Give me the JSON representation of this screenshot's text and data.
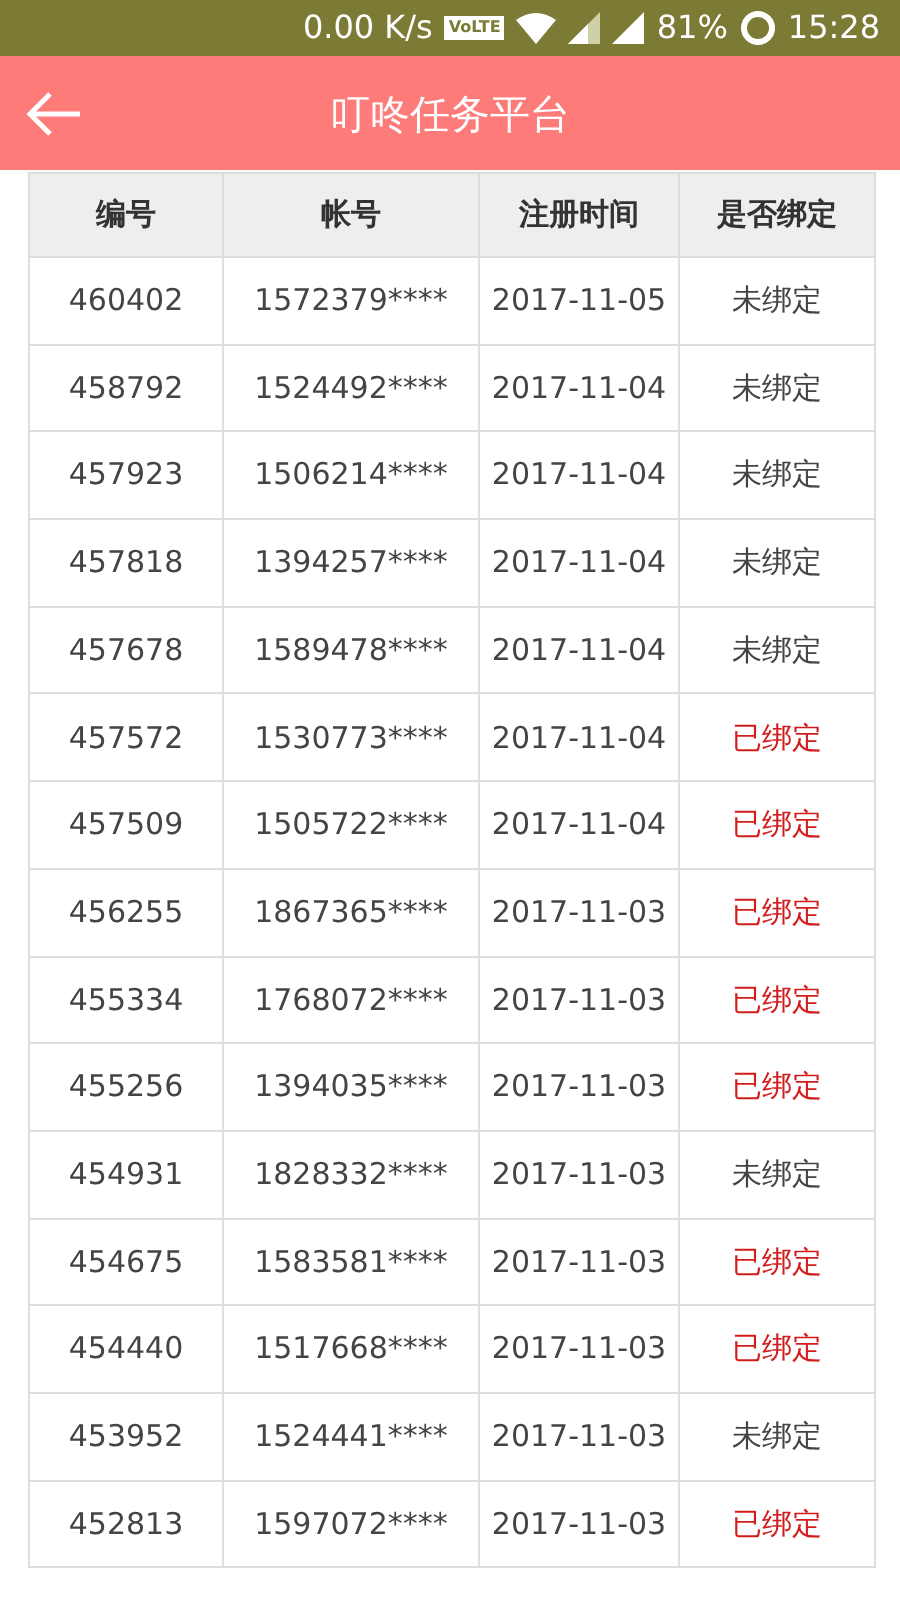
{
  "status_bar": {
    "speed": "0.00 K/s",
    "volte": "VoLTE",
    "battery": "81%",
    "time": "15:28"
  },
  "header": {
    "title": "叮咚任务平台"
  },
  "table": {
    "columns": [
      "编号",
      "帐号",
      "注册时间",
      "是否绑定"
    ],
    "rows": [
      {
        "id": "460402",
        "account": "1572379****",
        "date": "2017-11-05",
        "status": "未绑定",
        "bound": false
      },
      {
        "id": "458792",
        "account": "1524492****",
        "date": "2017-11-04",
        "status": "未绑定",
        "bound": false
      },
      {
        "id": "457923",
        "account": "1506214****",
        "date": "2017-11-04",
        "status": "未绑定",
        "bound": false
      },
      {
        "id": "457818",
        "account": "1394257****",
        "date": "2017-11-04",
        "status": "未绑定",
        "bound": false
      },
      {
        "id": "457678",
        "account": "1589478****",
        "date": "2017-11-04",
        "status": "未绑定",
        "bound": false
      },
      {
        "id": "457572",
        "account": "1530773****",
        "date": "2017-11-04",
        "status": "已绑定",
        "bound": true
      },
      {
        "id": "457509",
        "account": "1505722****",
        "date": "2017-11-04",
        "status": "已绑定",
        "bound": true
      },
      {
        "id": "456255",
        "account": "1867365****",
        "date": "2017-11-03",
        "status": "已绑定",
        "bound": true
      },
      {
        "id": "455334",
        "account": "1768072****",
        "date": "2017-11-03",
        "status": "已绑定",
        "bound": true
      },
      {
        "id": "455256",
        "account": "1394035****",
        "date": "2017-11-03",
        "status": "已绑定",
        "bound": true
      },
      {
        "id": "454931",
        "account": "1828332****",
        "date": "2017-11-03",
        "status": "未绑定",
        "bound": false
      },
      {
        "id": "454675",
        "account": "1583581****",
        "date": "2017-11-03",
        "status": "已绑定",
        "bound": true
      },
      {
        "id": "454440",
        "account": "1517668****",
        "date": "2017-11-03",
        "status": "已绑定",
        "bound": true
      },
      {
        "id": "453952",
        "account": "1524441****",
        "date": "2017-11-03",
        "status": "未绑定",
        "bound": false
      },
      {
        "id": "452813",
        "account": "1597072****",
        "date": "2017-11-03",
        "status": "已绑定",
        "bound": true
      }
    ]
  }
}
